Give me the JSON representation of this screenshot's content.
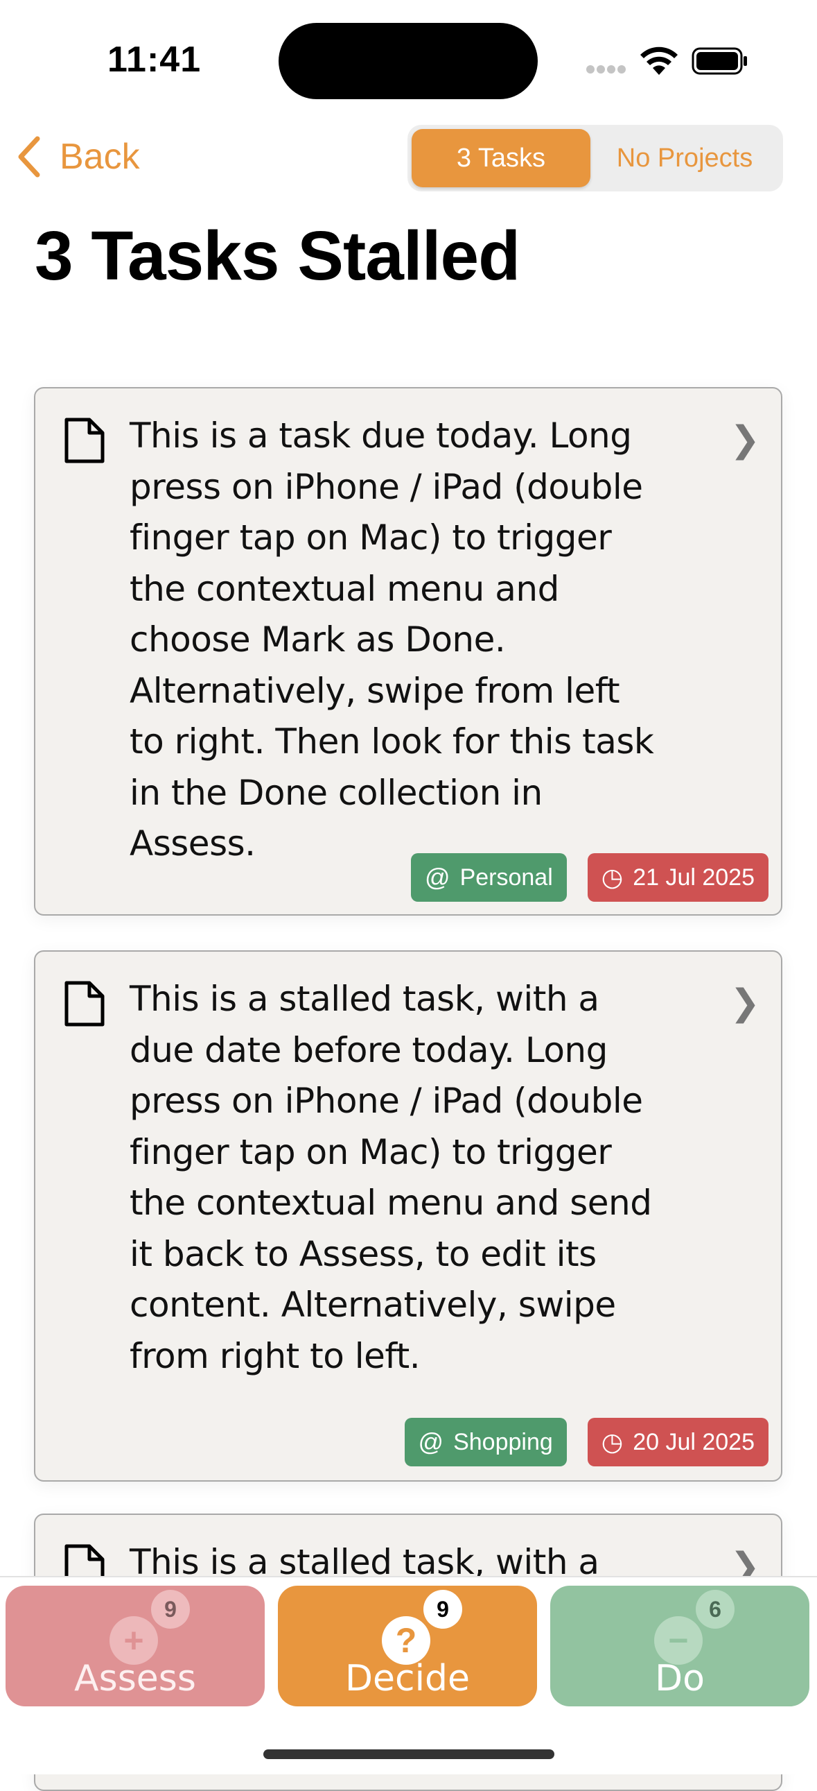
{
  "status_bar": {
    "time": "11:41"
  },
  "nav": {
    "back_label": "Back",
    "segments": [
      {
        "label": "3 Tasks",
        "selected": true
      },
      {
        "label": "No Projects",
        "selected": false
      }
    ]
  },
  "page_title": "3 Tasks Stalled",
  "tasks": [
    {
      "text": "This is a task due today. Long press on iPhone / iPad (double finger tap on Mac) to trigger the contextual menu and choose Mark as Done. Alternatively, swipe from left to right. Then look for this task in the Done collection in Assess.",
      "context": "Personal",
      "due": "21 Jul 2025"
    },
    {
      "text": "This is a stalled task, with a due date before today. Long press on iPhone / iPad (double finger tap on Mac) to trigger the contextual menu and send it back to Assess, to edit its content. Alternatively, swipe from right to left.",
      "context": "Shopping",
      "due": "20 Jul 2025"
    },
    {
      "text": "This is a stalled task, with a due"
    }
  ],
  "tab_bar": {
    "assess": {
      "label": "Assess",
      "count": "9",
      "icon": "plus-icon"
    },
    "decide": {
      "label": "Decide",
      "count": "9",
      "icon": "question-icon"
    },
    "do": {
      "label": "Do",
      "count": "6",
      "icon": "minus-icon"
    }
  },
  "colors": {
    "accent": "#E8963E",
    "context_tag": "#4f9a6c",
    "date_tag": "#cf5252",
    "assess_tab": "#df9294",
    "do_tab": "#92c3a0"
  }
}
